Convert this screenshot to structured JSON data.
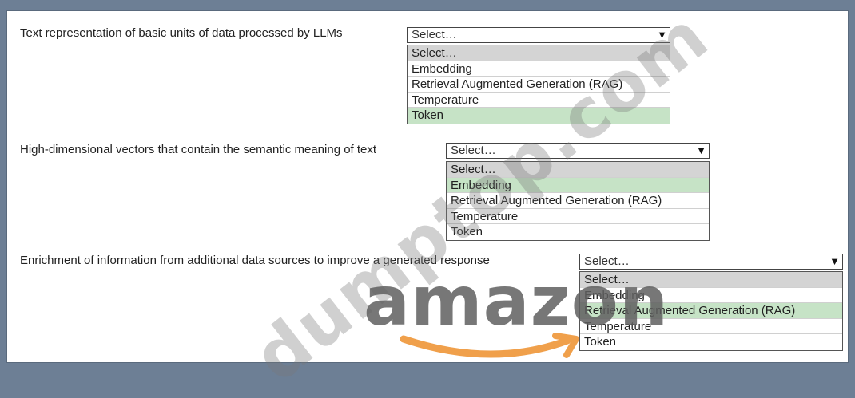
{
  "questions": [
    {
      "prompt": "Text representation of basic units of data processed by LLMs",
      "select_value": "Select…",
      "options": [
        "Select…",
        "Embedding",
        "Retrieval Augmented Generation (RAG)",
        "Temperature",
        "Token"
      ],
      "selected_index": 4
    },
    {
      "prompt": "High-dimensional vectors that contain the semantic meaning of text",
      "select_value": "Select…",
      "options": [
        "Select…",
        "Embedding",
        "Retrieval Augmented Generation (RAG)",
        "Temperature",
        "Token"
      ],
      "selected_index": 1
    },
    {
      "prompt": "Enrichment of information from additional data sources to improve a generated response",
      "select_value": "Select…",
      "options": [
        "Select…",
        "Embedding",
        "Retrieval Augmented Generation (RAG)",
        "Temperature",
        "Token"
      ],
      "selected_index": 2
    }
  ],
  "watermark": {
    "site": "dumptop.com",
    "logo": "amazon"
  },
  "colors": {
    "highlight": "#c6e3c6",
    "placeholder_bg": "#d4d4d4",
    "frame": "#6d7f95",
    "logo_arrow": "#f0a04b"
  }
}
